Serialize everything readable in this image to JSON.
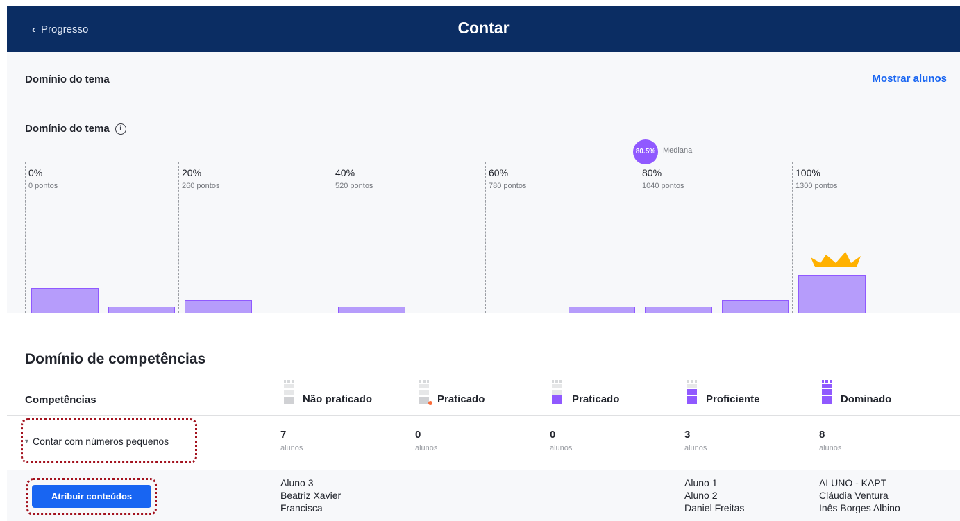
{
  "header": {
    "back_label": "Progresso",
    "title": "Contar"
  },
  "topic": {
    "section_title": "Domínio do tema",
    "show_students_link": "Mostrar alunos",
    "chart_title": "Domínio do tema"
  },
  "chart_data": {
    "type": "bar",
    "title": "Domínio do tema",
    "ticks": [
      {
        "label": "0%",
        "sub": "0 pontos"
      },
      {
        "label": "20%",
        "sub": "260 pontos"
      },
      {
        "label": "40%",
        "sub": "520 pontos"
      },
      {
        "label": "60%",
        "sub": "780 pontos"
      },
      {
        "label": "80%",
        "sub": "1040 pontos"
      },
      {
        "label": "100%",
        "sub": "1300 pontos"
      }
    ],
    "bins": [
      {
        "from_pct": 0,
        "to_pct": 10,
        "students": 4
      },
      {
        "from_pct": 10,
        "to_pct": 20,
        "students": 1
      },
      {
        "from_pct": 20,
        "to_pct": 30,
        "students": 2
      },
      {
        "from_pct": 40,
        "to_pct": 50,
        "students": 1
      },
      {
        "from_pct": 70,
        "to_pct": 80,
        "students": 1
      },
      {
        "from_pct": 80,
        "to_pct": 90,
        "students": 1
      },
      {
        "from_pct": 90,
        "to_pct": 100,
        "students": 2
      },
      {
        "from_pct": 100,
        "to_pct": 110,
        "students": 6
      }
    ],
    "median": {
      "value_label": "80.5%",
      "label": "Mediana",
      "value_pct": 80.5
    },
    "colors": {
      "bar": "#b69cfb",
      "bar_border": "#9059ff",
      "median": "#9059ff",
      "crown": "#ffb100"
    }
  },
  "skills": {
    "title": "Domínio de competências",
    "column_label": "Competências",
    "levels": [
      {
        "name": "Não praticado",
        "count": "7",
        "unit": "alunos",
        "students": [
          "Aluno 3",
          "Beatriz Xavier",
          "Francisca"
        ]
      },
      {
        "name": "Praticado",
        "count": "0",
        "unit": "alunos",
        "students": []
      },
      {
        "name": "Praticado",
        "count": "0",
        "unit": "alunos",
        "students": []
      },
      {
        "name": "Proficiente",
        "count": "3",
        "unit": "alunos",
        "students": [
          "Aluno 1",
          "Aluno 2",
          "Daniel Freitas"
        ]
      },
      {
        "name": "Dominado",
        "count": "8",
        "unit": "alunos",
        "students": [
          "ALUNO - KAPT",
          "Cláudia Ventura",
          "Inês Borges Albino"
        ]
      }
    ],
    "skill_name": "Contar com números pequenos",
    "assign_button": "Atribuir conteúdos"
  }
}
